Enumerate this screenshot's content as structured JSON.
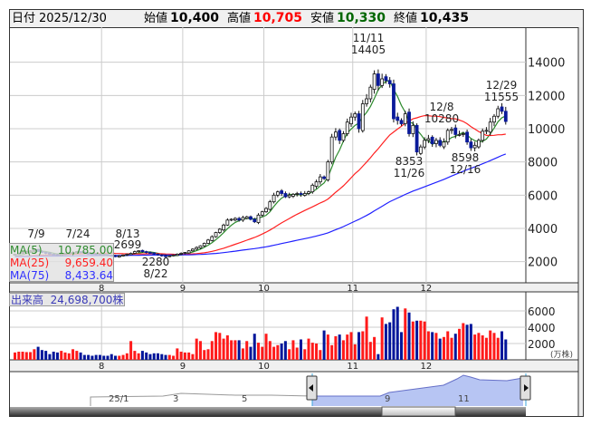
{
  "header": {
    "date_label": "日付",
    "date": "2025/12/30",
    "open_label": "始値",
    "open": "10,400",
    "high_label": "高値",
    "high": "10,705",
    "low_label": "安値",
    "low": "10,330",
    "close_label": "終値",
    "close": "10,435"
  },
  "colors": {
    "up_volume": "#ff1a1a",
    "down_volume": "#00159a",
    "down_candle": "#0a1a9a",
    "ma5": "#2e8b2e",
    "ma25": "#ff2020",
    "ma75": "#2020ff",
    "high_text": "#ff0000",
    "low_text": "#006600"
  },
  "ma_legend": [
    {
      "label": "MA(5)",
      "value": "10,785.00"
    },
    {
      "label": "MA(25)",
      "value": "9,659.40"
    },
    {
      "label": "MA(75)",
      "value": "8,433.64"
    }
  ],
  "volume_legend": {
    "label": "出来高",
    "value": "24,698,700株"
  },
  "annotations": {
    "a1": {
      "date": "7/9"
    },
    "a2": {
      "date": "7/24"
    },
    "a3": {
      "date": "8/13",
      "value": "2699"
    },
    "a4": {
      "date": "8/22",
      "value": "2280"
    },
    "a5": {
      "date": "11/11",
      "value": "14405"
    },
    "a6": {
      "date": "11/26",
      "value": "8353"
    },
    "a7": {
      "date": "12/8",
      "value": "10280"
    },
    "a8": {
      "date": "12/16",
      "value": "8598"
    },
    "a9": {
      "date": "12/29",
      "value": "11555"
    }
  },
  "navigator": {
    "labels": [
      "25/1",
      "3",
      "5",
      "9",
      "11"
    ]
  },
  "chart_data": {
    "type": "candlestick",
    "price_axis": {
      "ticks": [
        "14000",
        "12000",
        "10000",
        "8000",
        "6000",
        "4000",
        "2000"
      ],
      "values": [
        14000,
        12000,
        10000,
        8000,
        6000,
        4000,
        2000
      ]
    },
    "volume_axis": {
      "ticks": [
        "6000",
        "4000",
        "2000"
      ],
      "values": [
        6000,
        4000,
        2000
      ],
      "unit": "(万株)"
    },
    "month_labels": [
      "8",
      "9",
      "10",
      "11",
      "12"
    ],
    "month_start_index": [
      23,
      44,
      65,
      88,
      107
    ],
    "close": [
      2450,
      2500,
      2560,
      2600,
      2650,
      2700,
      2620,
      2560,
      2500,
      2450,
      2420,
      2400,
      2450,
      2500,
      2520,
      2560,
      2600,
      2550,
      2500,
      2480,
      2450,
      2430,
      2420,
      2400,
      2380,
      2350,
      2300,
      2350,
      2400,
      2450,
      2500,
      2600,
      2650,
      2600,
      2550,
      2500,
      2450,
      2400,
      2350,
      2300,
      2350,
      2400,
      2450,
      2500,
      2550,
      2650,
      2750,
      2850,
      2950,
      3100,
      3300,
      3500,
      3750,
      3950,
      4200,
      4500,
      4550,
      4600,
      4500,
      4650,
      4700,
      4550,
      4400,
      4800,
      5000,
      5200,
      5600,
      6000,
      6200,
      6100,
      5900,
      6000,
      6050,
      6100,
      6050,
      6100,
      6200,
      6600,
      6800,
      7100,
      7000,
      8000,
      9500,
      9800,
      9300,
      9700,
      10400,
      10700,
      10900,
      10000,
      11500,
      11800,
      12500,
      13300,
      12600,
      13000,
      12900,
      12700,
      10600,
      10500,
      10300,
      10900,
      9700,
      10200,
      8600,
      8900,
      9300,
      9400,
      9100,
      9300,
      9000,
      9200,
      9900,
      9950,
      9650,
      9650,
      9700,
      9200,
      8850,
      9000,
      9300,
      9850,
      9900,
      10400,
      10750,
      11200,
      11050,
      10435
    ],
    "volume": [
      900,
      1000,
      1000,
      950,
      950,
      1300,
      1600,
      1200,
      1100,
      700,
      1000,
      900,
      1100,
      900,
      800,
      1300,
      1100,
      900,
      600,
      600,
      500,
      600,
      600,
      500,
      500,
      700,
      500,
      500,
      600,
      800,
      2300,
      1100,
      800,
      1100,
      900,
      700,
      800,
      800,
      700,
      600,
      600,
      500,
      1400,
      1000,
      900,
      900,
      700,
      2600,
      2300,
      1200,
      1300,
      2300,
      3400,
      3300,
      2600,
      3000,
      2400,
      2400,
      2400,
      1400,
      2300,
      1600,
      3200,
      2100,
      1600,
      3200,
      2300,
      1600,
      1800,
      2000,
      2300,
      1300,
      2400,
      1500,
      2500,
      1300,
      2600,
      2100,
      2000,
      1200,
      3600,
      3100,
      1800,
      2900,
      3100,
      2400,
      3100,
      3400,
      1900,
      3400,
      3500,
      5300,
      2200,
      2800,
      700,
      5200,
      4400,
      4600,
      6200,
      6500,
      3400,
      6300,
      5800,
      4700,
      4800,
      4800,
      4700,
      3500,
      3400,
      3300,
      2600,
      2800,
      3500,
      2700,
      3200,
      3800,
      4500,
      4300,
      4400,
      3100,
      3300,
      3000,
      2700,
      3600,
      3300,
      2700,
      3500,
      2500
    ],
    "moving_averages": [
      "MA(5)",
      "MA(25)",
      "MA(75)"
    ]
  }
}
